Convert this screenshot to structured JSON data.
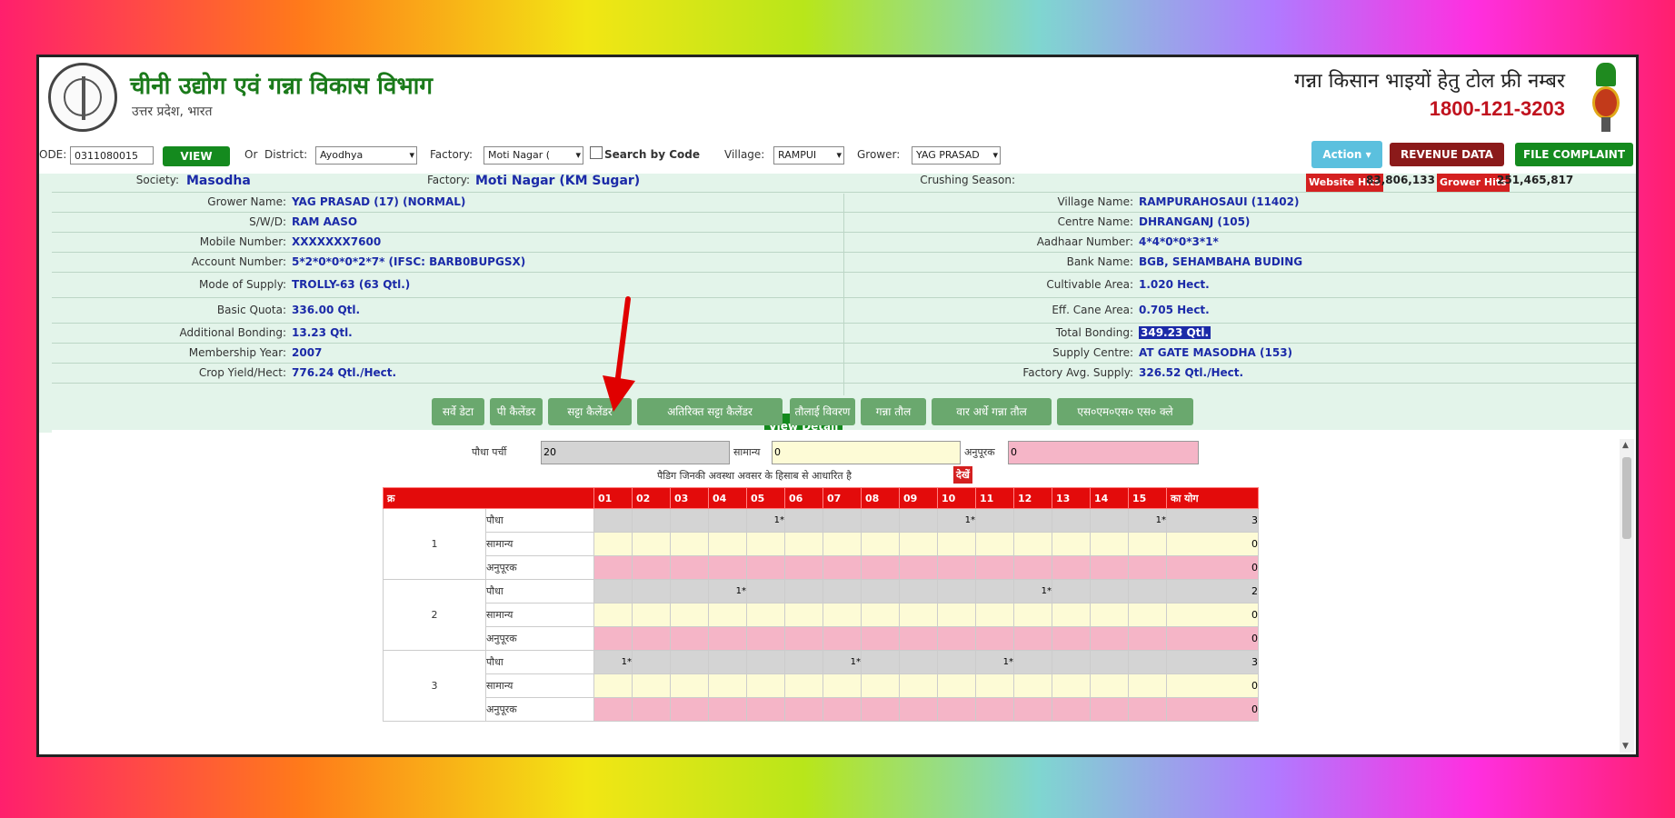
{
  "header": {
    "department": "चीनी उद्योग एवं गन्ना विकास विभाग",
    "state": "उत्तर प्रदेश, भारत",
    "toll_title": "गन्ना किसान भाइयों हेतु टोल फ्री नम्बर",
    "toll_number": "1800-121-3203"
  },
  "filters": {
    "code_label": "ODE:",
    "code_value": "0311080015",
    "view_label": "VIEW",
    "or_label": "Or",
    "district_label": "District:",
    "district_value": "Ayodhya",
    "factory_label": "Factory:",
    "factory_value": "Moti Nagar (",
    "search_by_code": "Search by Code",
    "village_label": "Village:",
    "village_value": "RAMPUI",
    "grower_label": "Grower:",
    "grower_value": "YAG PRASAD",
    "action_label": "Action",
    "revenue_label": "REVENUE DATA",
    "complaint_label": "FILE COMPLAINT"
  },
  "info": {
    "society_label": "Society:",
    "society_value": "Masodha",
    "factory_label": "Factory:",
    "factory_value": "Moti Nagar (KM Sugar)",
    "crushing_label": "Crushing Season:",
    "website_hits_label": "Website Hits",
    "website_hits_value": "83,806,133",
    "grower_hits_label": "Grower Hits",
    "grower_hits_value": "251,465,817",
    "left": [
      {
        "label": "Grower Name:",
        "value": "YAG PRASAD (17) (NORMAL)"
      },
      {
        "label": "S/W/D:",
        "value": "RAM AASO"
      },
      {
        "label": "Mobile Number:",
        "value": "XXXXXXX7600"
      },
      {
        "label": "Account Number:",
        "value": "5*2*0*0*0*2*7* (IFSC: BARB0BUPGSX)"
      },
      {
        "label": "Mode of Supply:",
        "value": "TROLLY-63 (63 Qtl.)"
      },
      {
        "label": "Basic Quota:",
        "value": "336.00 Qtl."
      },
      {
        "label": "Additional Bonding:",
        "value": "13.23 Qtl."
      },
      {
        "label": "Membership Year:",
        "value": "2007"
      },
      {
        "label": "Crop Yield/Hect:",
        "value": "776.24 Qtl./Hect."
      }
    ],
    "right": [
      {
        "label": "Village Name:",
        "value": "RAMPURAHOSAUI (11402)"
      },
      {
        "label": "Centre Name:",
        "value": "DHRANGANJ (105)"
      },
      {
        "label": "Aadhaar Number:",
        "value": "4*4*0*0*3*1*"
      },
      {
        "label": "Bank Name:",
        "value": "BGB, SEHAMBAHA BUDING"
      },
      {
        "label": "Cultivable Area:",
        "value": "1.020 Hect."
      },
      {
        "label": "Eff. Cane Area:",
        "value": "0.705 Hect."
      },
      {
        "label": "Total Bonding:",
        "value": "349.23 Qtl."
      },
      {
        "label": "Supply Centre:",
        "value": "AT GATE MASODHA (153)"
      },
      {
        "label": "Factory Avg. Supply:",
        "value": "326.52 Qtl./Hect."
      }
    ],
    "view_detail": "View Detail"
  },
  "tabs": [
    "सर्वे डेटा",
    "पी कैलेंडर",
    "सट्टा कैलेंडर",
    "अतिरिक्त सट्टा कैलेंडर",
    "तौलाई विवरण",
    "गन्ना तौल",
    "वार अर्धे गन्ना तौल",
    "एस०एम०एस० एस० क्ले"
  ],
  "calendar": {
    "totals_label_1": "पौधा पर्ची",
    "totals_value_1": "20",
    "totals_label_2": "सामान्य",
    "totals_value_2": "0",
    "totals_label_3": "अनुपूरक",
    "totals_value_3": "0",
    "note": "पैडिग जिनकी अवस्था अवसर के हिसाब से आधारित है",
    "note_badge": "देखें",
    "header_first": "क्र",
    "days": [
      "01",
      "02",
      "03",
      "04",
      "05",
      "06",
      "07",
      "08",
      "09",
      "10",
      "11",
      "12",
      "13",
      "14",
      "15"
    ],
    "total_header": "का योग",
    "row_labels": [
      "पौधा",
      "सामान्य",
      "अनुपूरक"
    ],
    "groups": [
      {
        "no": "1",
        "rows": [
          [
            "",
            "",
            "",
            "",
            "1*",
            "",
            "",
            "",
            "",
            "1*",
            "",
            "",
            "",
            "",
            "1*"
          ],
          [
            "",
            "",
            "",
            "",
            "",
            "",
            "",
            "",
            "",
            "",
            "",
            "",
            "",
            "",
            ""
          ],
          [
            "",
            "",
            "",
            "",
            "",
            "",
            "",
            "",
            "",
            "",
            "",
            "",
            "",
            "",
            ""
          ]
        ],
        "totals": [
          "3",
          "0",
          "0"
        ]
      },
      {
        "no": "2",
        "rows": [
          [
            "",
            "",
            "",
            "1*",
            "",
            "",
            "",
            "",
            "",
            "",
            "",
            "1*",
            "",
            "",
            ""
          ],
          [
            "",
            "",
            "",
            "",
            "",
            "",
            "",
            "",
            "",
            "",
            "",
            "",
            "",
            "",
            ""
          ],
          [
            "",
            "",
            "",
            "",
            "",
            "",
            "",
            "",
            "",
            "",
            "",
            "",
            "",
            "",
            ""
          ]
        ],
        "totals": [
          "2",
          "0",
          "0"
        ]
      },
      {
        "no": "3",
        "rows": [
          [
            "1*",
            "",
            "",
            "",
            "",
            "",
            "1*",
            "",
            "",
            "",
            "1*",
            "",
            "",
            "",
            ""
          ],
          [
            "",
            "",
            "",
            "",
            "",
            "",
            "",
            "",
            "",
            "",
            "",
            "",
            "",
            "",
            ""
          ],
          [
            "",
            "",
            "",
            "",
            "",
            "",
            "",
            "",
            "",
            "",
            "",
            "",
            "",
            "",
            ""
          ]
        ],
        "totals": [
          "3",
          "0",
          "0"
        ]
      }
    ]
  },
  "colors": {
    "header_green": "#1a7a1a",
    "info_bg": "#e3f4ea",
    "value_blue": "#1b2aa8",
    "calendar_red": "#e30b0b",
    "tab_green": "#6aa86e",
    "arrow": "#e00000"
  }
}
